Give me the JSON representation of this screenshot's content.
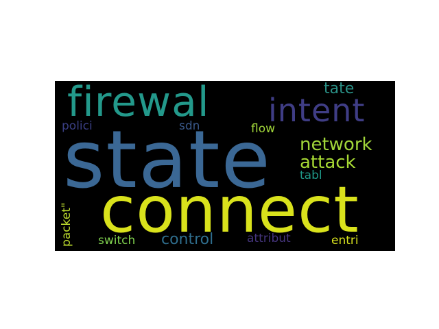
{
  "word_cloud": {
    "background": "#000000",
    "words": {
      "state": {
        "text": "state",
        "color": "#3b6895"
      },
      "connect": {
        "text": "connect",
        "color": "#d9e21c"
      },
      "firewal": {
        "text": "firewal",
        "color": "#23998b"
      },
      "intent": {
        "text": "intent",
        "color": "#3f3d85"
      },
      "network": {
        "text": "network",
        "color": "#a1d63a"
      },
      "attack": {
        "text": "attack",
        "color": "#a8da34"
      },
      "tate": {
        "text": "tate",
        "color": "#2a9187"
      },
      "polici": {
        "text": "polici",
        "color": "#3a3f84"
      },
      "sdn": {
        "text": "sdn",
        "color": "#39588a"
      },
      "flow": {
        "text": "flow",
        "color": "#a1d63a"
      },
      "tabl": {
        "text": "tabl",
        "color": "#1f9a89"
      },
      "packet": {
        "text": "packet\"",
        "color": "#bedd2e"
      },
      "switch": {
        "text": "switch",
        "color": "#80d24f"
      },
      "control": {
        "text": "control",
        "color": "#2f6e8e"
      },
      "attribut": {
        "text": "attribut",
        "color": "#45357d"
      },
      "entri": {
        "text": "entri",
        "color": "#d8e21e"
      }
    }
  }
}
